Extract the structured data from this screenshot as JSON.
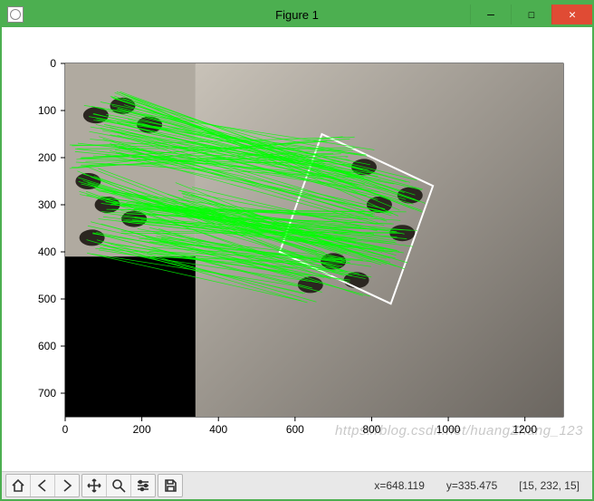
{
  "window": {
    "title": "Figure 1"
  },
  "toolbar": {
    "buttons": [
      {
        "id": "home"
      },
      {
        "id": "back"
      },
      {
        "id": "forward"
      },
      {
        "id": "pan"
      },
      {
        "id": "zoom"
      },
      {
        "id": "subplots"
      },
      {
        "id": "save"
      }
    ]
  },
  "status": {
    "x_label": "x=648.119",
    "y_label": "y=335.475",
    "pixel": "[15, 232, 15]"
  },
  "watermark": "https://blog.csdn.net/huangZhang_123",
  "chart_data": {
    "type": "line",
    "title": "",
    "xlabel": "",
    "ylabel": "",
    "xlim": [
      0,
      1300
    ],
    "ylim": [
      750,
      0
    ],
    "xticks": [
      0,
      200,
      400,
      600,
      800,
      1000,
      1200
    ],
    "yticks": [
      0,
      100,
      200,
      300,
      400,
      500,
      600,
      700
    ],
    "content": "Feature-correspondence visualization: two grayscale images of a hand-on-forearm region shown side-by-side. Left image spans roughly x=[0,340], y=[0,410] with a black fill below it to y≈750. Right image spans x≈[340,1300], y=[0,750] and contains a white rotated rectangle (approx corners (670,150),(960,260),(850,510),(560,400)) marking the detected region. Hundreds of bright-green line segments connect keypoints in the left image to corresponding keypoints inside the white rectangle on the right, forming an hourglass-shaped bundle crossing near x≈450.",
    "match_lines_sample": [
      {
        "x1": 80,
        "y1": 110,
        "x2": 780,
        "y2": 220
      },
      {
        "x1": 120,
        "y1": 160,
        "x2": 820,
        "y2": 300
      },
      {
        "x1": 60,
        "y1": 250,
        "x2": 700,
        "y2": 420
      },
      {
        "x1": 180,
        "y1": 330,
        "x2": 880,
        "y2": 360
      },
      {
        "x1": 220,
        "y1": 380,
        "x2": 760,
        "y2": 460
      },
      {
        "x1": 150,
        "y1": 90,
        "x2": 900,
        "y2": 280
      },
      {
        "x1": 90,
        "y1": 370,
        "x2": 640,
        "y2": 470
      },
      {
        "x1": 40,
        "y1": 190,
        "x2": 720,
        "y2": 200
      },
      {
        "x1": 300,
        "y1": 280,
        "x2": 850,
        "y2": 400
      },
      {
        "x1": 110,
        "y1": 300,
        "x2": 790,
        "y2": 350
      }
    ],
    "detection_rect": [
      {
        "x": 670,
        "y": 150
      },
      {
        "x": 960,
        "y": 260
      },
      {
        "x": 850,
        "y": 510
      },
      {
        "x": 560,
        "y": 400
      }
    ]
  }
}
